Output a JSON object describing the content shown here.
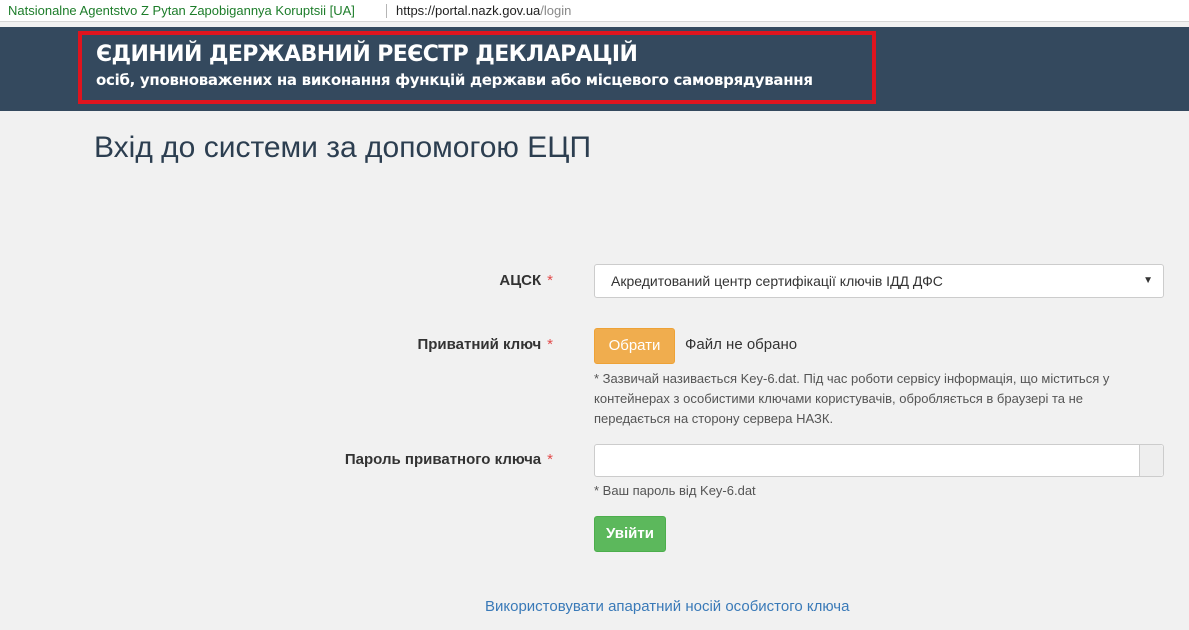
{
  "address_bar": {
    "site_identity": "Natsionalne Agentstvo Z Pytan Zapobigannya Koruptsii [UA]",
    "url_host": "https://portal.nazk.gov.ua",
    "url_path": "/login"
  },
  "header": {
    "title": "ЄДИНИЙ ДЕРЖАВНИЙ РЕЄСТР ДЕКЛАРАЦІЙ",
    "subtitle": "осіб, уповноважених на виконання функцій держави або місцевого самоврядування",
    "border_color": "#e0141e",
    "background": "#34495e"
  },
  "page": {
    "title": "Вхід до системи за допомогою ЕЦП"
  },
  "form": {
    "required_mark": "*",
    "acsk": {
      "label": "АЦСК",
      "selected": "Акредитований центр сертифікації ключів ІДД ДФС",
      "caret": "▼"
    },
    "private_key": {
      "label": "Приватний ключ",
      "button": "Обрати",
      "status": "Файл не обрано",
      "help": "* Зазвичай називається Key-6.dat. Під час роботи сервісу інформація, що міститься у контейнерах з особистими ключами користувачів, обробляється в браузері та не передається на сторону сервера НАЗК."
    },
    "password": {
      "label": "Пароль приватного ключа",
      "value": "",
      "help": "* Ваш пароль від Key-6.dat"
    },
    "submit": "Увійти"
  },
  "footer": {
    "hardware_link": "Використовувати апаратний носій особистого ключа"
  },
  "colors": {
    "choose_button": "#f0ad4e",
    "login_button": "#5cb85c",
    "link": "#3a7ab8",
    "required": "#e24a4a"
  }
}
